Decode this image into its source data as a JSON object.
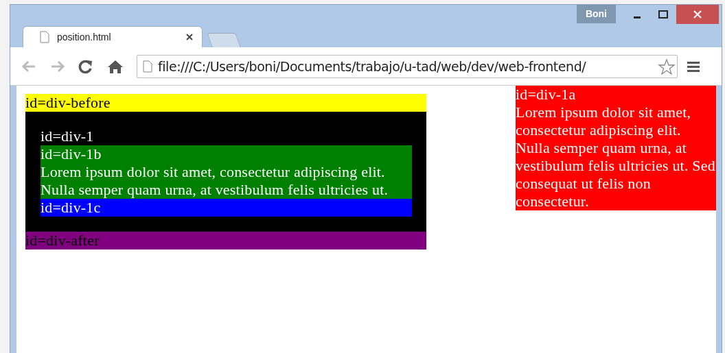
{
  "window": {
    "user": "Boni"
  },
  "tabs": [
    {
      "title": "position.html",
      "selected": true
    }
  ],
  "address_bar": {
    "value": "file:///C:/Users/boni/Documents/trabajo/u-tad/web/dev/web-frontend/"
  },
  "page": {
    "main": [
      {
        "kind": "plain",
        "label": "id=div-before",
        "color": "#ffff00"
      },
      {
        "kind": "container",
        "label": "id=div-1",
        "color": "#000000",
        "children": [
          {
            "label": "id=div-1b",
            "text": "Lorem ipsum dolor sit amet, consectetur adipiscing elit. Nulla semper quam urna, at vestibulum felis ultricies ut.",
            "color": "#008000"
          },
          {
            "label": "id=div-1c",
            "color": "#0000ff"
          }
        ]
      },
      {
        "kind": "plain",
        "label": "id=div-after",
        "color": "#800080"
      }
    ],
    "side": {
      "label": "id=div-1a",
      "text": "Lorem ipsum dolor sit amet, consectetur adipiscing elit. Nulla semper quam urna, at vestibulum felis ultricies ut. Sed consequat ut felis non consectetur.",
      "color": "#ff0000"
    }
  }
}
